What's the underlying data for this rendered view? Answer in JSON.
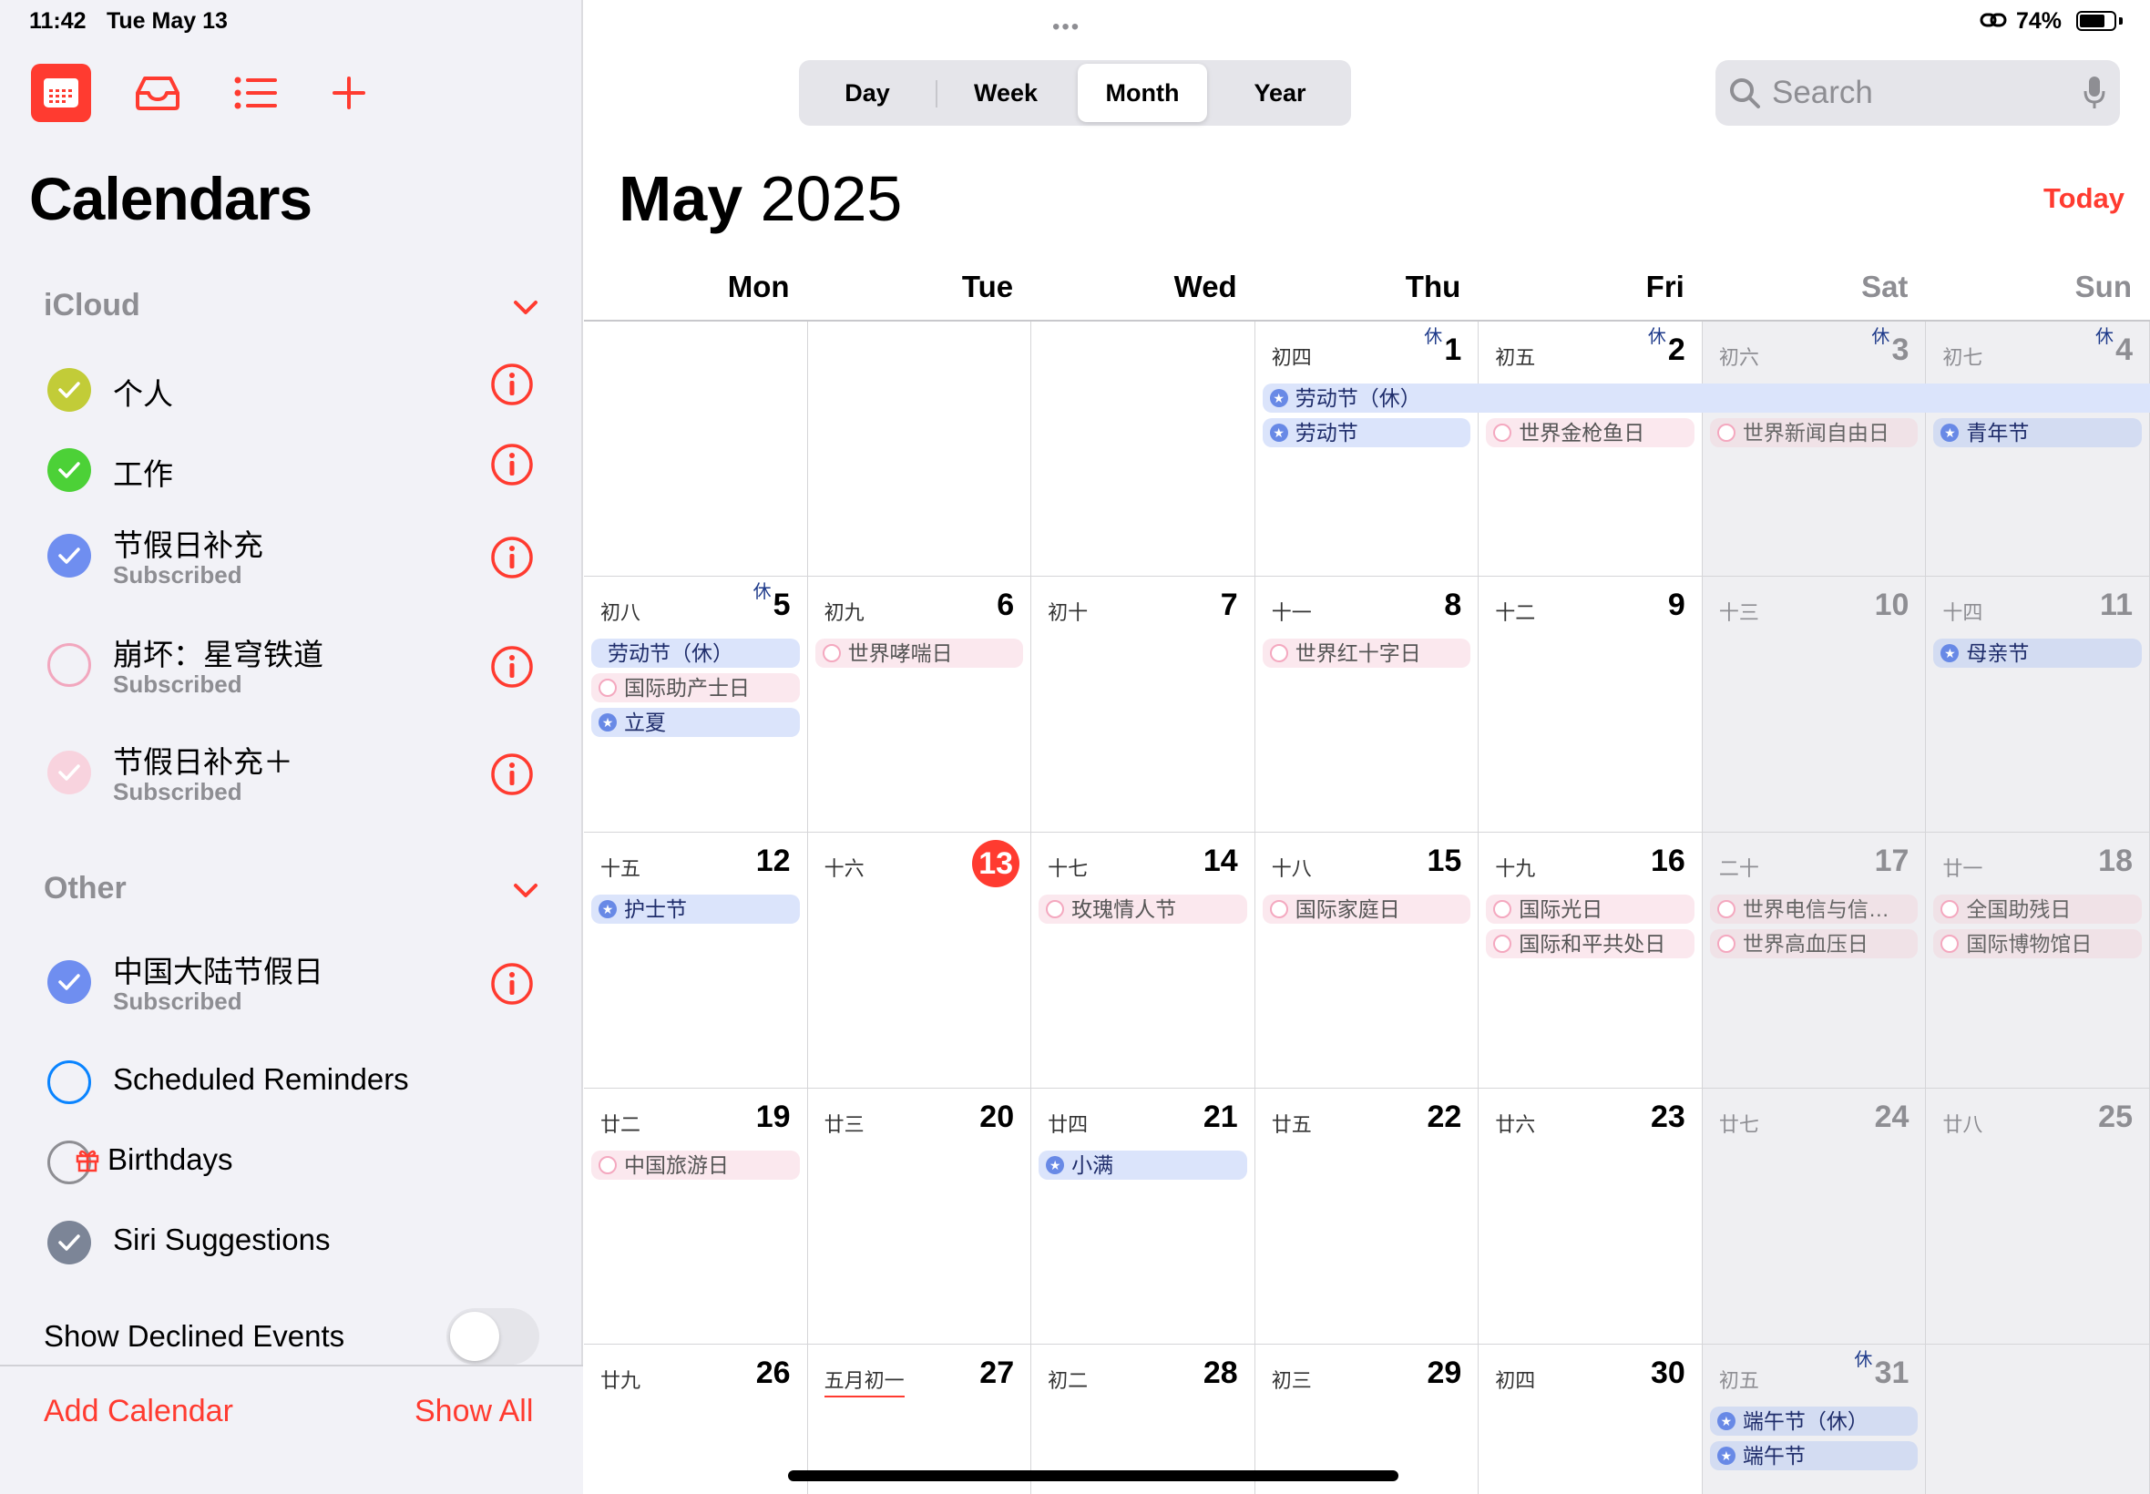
{
  "status": {
    "time": "11:42",
    "date": "Tue May 13",
    "battery": "74%",
    "battery_level": 0.74
  },
  "sidebar": {
    "title": "Calendars",
    "icloud_header": "iCloud",
    "other_header": "Other",
    "icloud": [
      {
        "name": "个人",
        "subtitle": "",
        "color": "#c2cc38",
        "checked": true
      },
      {
        "name": "工作",
        "subtitle": "",
        "color": "#4cd137",
        "checked": true
      },
      {
        "name": "节假日补充",
        "subtitle": "Subscribed",
        "color": "#6f8ef0",
        "checked": true
      },
      {
        "name": "崩坏：星穹铁道",
        "subtitle": "Subscribed",
        "color": "#f2a7be",
        "checked": false
      },
      {
        "name": "节假日补充＋",
        "subtitle": "Subscribed",
        "color": "#f8d3de",
        "checked": true
      }
    ],
    "other": [
      {
        "name": "中国大陆节假日",
        "subtitle": "Subscribed",
        "color": "#6f8ef0",
        "checked": true
      },
      {
        "name": "Scheduled Reminders",
        "subtitle": "",
        "color": "#0a84ff",
        "checked": false
      },
      {
        "name": "Birthdays",
        "subtitle": "",
        "color": "#8e8e93",
        "checked": false
      },
      {
        "name": "Siri Suggestions",
        "subtitle": "",
        "color": "#7c8597",
        "checked": true
      }
    ],
    "show_declined_label": "Show Declined Events",
    "show_declined_on": false,
    "add_calendar": "Add Calendar",
    "show_all": "Show All"
  },
  "toolbar": {
    "views": [
      "Day",
      "Week",
      "Month",
      "Year"
    ],
    "active_view": "Month",
    "search_placeholder": "Search"
  },
  "header": {
    "month": "May",
    "year": "2025",
    "today_button": "Today"
  },
  "weekdays": [
    "Mon",
    "Tue",
    "Wed",
    "Thu",
    "Fri",
    "Sat",
    "Sun"
  ],
  "weeks": [
    [
      null,
      null,
      null,
      {
        "day": "1",
        "lunar": "初四",
        "xiu": "休",
        "events": [
          {
            "t": "劳动节（休）",
            "c": "blue",
            "span": 4
          },
          {
            "t": "劳动节",
            "c": "blue"
          }
        ]
      },
      {
        "day": "2",
        "lunar": "初五",
        "xiu": "休",
        "events": [
          {
            "t": "",
            "c": "gap"
          },
          {
            "t": "世界金枪鱼日",
            "c": "pink"
          }
        ]
      },
      {
        "day": "3",
        "lunar": "初六",
        "xiu": "休",
        "events": [
          {
            "t": "",
            "c": "gap"
          },
          {
            "t": "世界新闻自由日",
            "c": "pink"
          }
        ]
      },
      {
        "day": "4",
        "lunar": "初七",
        "xiu": "休",
        "events": [
          {
            "t": "",
            "c": "gap"
          },
          {
            "t": "青年节",
            "c": "blue"
          }
        ]
      }
    ],
    [
      {
        "day": "5",
        "lunar": "初八",
        "xiu": "休",
        "events": [
          {
            "t": "劳动节（休）",
            "c": "blue",
            "noicon": true
          },
          {
            "t": "国际助产士日",
            "c": "pink"
          },
          {
            "t": "立夏",
            "c": "blue"
          }
        ]
      },
      {
        "day": "6",
        "lunar": "初九",
        "events": [
          {
            "t": "世界哮喘日",
            "c": "pink"
          }
        ]
      },
      {
        "day": "7",
        "lunar": "初十",
        "events": []
      },
      {
        "day": "8",
        "lunar": "十一",
        "events": [
          {
            "t": "世界红十字日",
            "c": "pink"
          }
        ]
      },
      {
        "day": "9",
        "lunar": "十二",
        "events": []
      },
      {
        "day": "10",
        "lunar": "十三",
        "events": []
      },
      {
        "day": "11",
        "lunar": "十四",
        "events": [
          {
            "t": "母亲节",
            "c": "blue"
          }
        ]
      }
    ],
    [
      {
        "day": "12",
        "lunar": "十五",
        "events": [
          {
            "t": "护士节",
            "c": "blue"
          }
        ]
      },
      {
        "day": "13",
        "lunar": "十六",
        "today": true,
        "events": []
      },
      {
        "day": "14",
        "lunar": "十七",
        "events": [
          {
            "t": "玫瑰情人节",
            "c": "pink"
          }
        ]
      },
      {
        "day": "15",
        "lunar": "十八",
        "events": [
          {
            "t": "国际家庭日",
            "c": "pink"
          }
        ]
      },
      {
        "day": "16",
        "lunar": "十九",
        "events": [
          {
            "t": "国际光日",
            "c": "pink"
          },
          {
            "t": "国际和平共处日",
            "c": "pink"
          }
        ]
      },
      {
        "day": "17",
        "lunar": "二十",
        "events": [
          {
            "t": "世界电信与信…",
            "c": "pink"
          },
          {
            "t": "世界高血压日",
            "c": "pink"
          }
        ]
      },
      {
        "day": "18",
        "lunar": "廿一",
        "events": [
          {
            "t": "全国助残日",
            "c": "pink"
          },
          {
            "t": "国际博物馆日",
            "c": "pink"
          }
        ]
      }
    ],
    [
      {
        "day": "19",
        "lunar": "廿二",
        "events": [
          {
            "t": "中国旅游日",
            "c": "pink"
          }
        ]
      },
      {
        "day": "20",
        "lunar": "廿三",
        "events": []
      },
      {
        "day": "21",
        "lunar": "廿四",
        "events": [
          {
            "t": "小满",
            "c": "blue"
          }
        ]
      },
      {
        "day": "22",
        "lunar": "廿五",
        "events": []
      },
      {
        "day": "23",
        "lunar": "廿六",
        "events": []
      },
      {
        "day": "24",
        "lunar": "廿七",
        "events": []
      },
      {
        "day": "25",
        "lunar": "廿八",
        "events": []
      }
    ],
    [
      {
        "day": "26",
        "lunar": "廿九",
        "events": []
      },
      {
        "day": "27",
        "lunar": "五月初一",
        "lunar_mark": true,
        "events": []
      },
      {
        "day": "28",
        "lunar": "初二",
        "events": []
      },
      {
        "day": "29",
        "lunar": "初三",
        "events": []
      },
      {
        "day": "30",
        "lunar": "初四",
        "events": []
      },
      {
        "day": "31",
        "lunar": "初五",
        "xiu": "休",
        "events": [
          {
            "t": "端午节（休）",
            "c": "blue"
          },
          {
            "t": "端午节",
            "c": "blue"
          }
        ]
      },
      null
    ]
  ]
}
